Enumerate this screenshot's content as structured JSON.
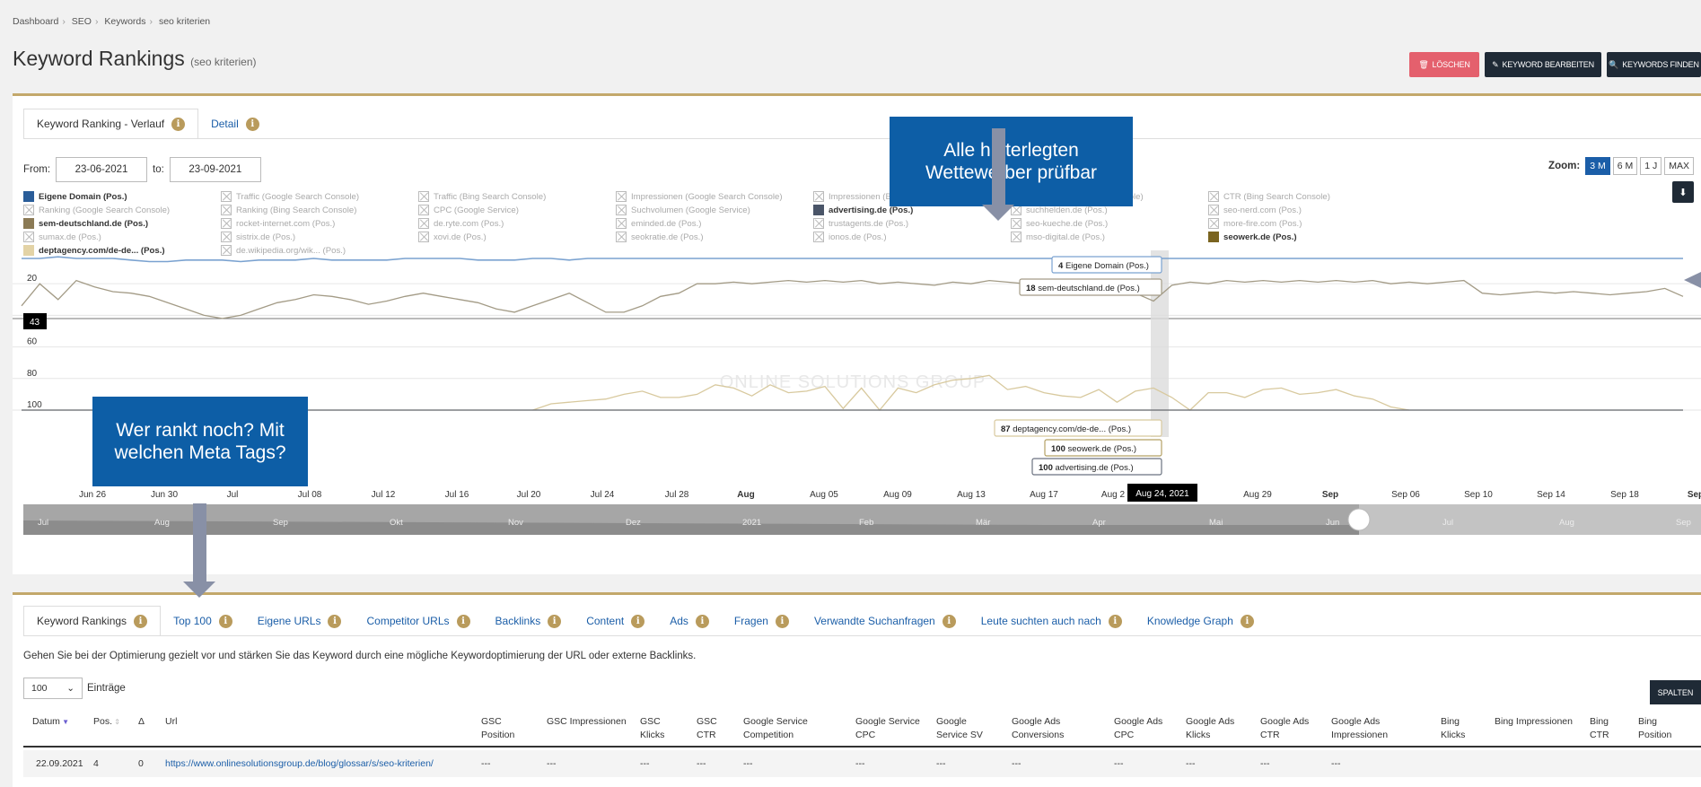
{
  "breadcrumb": [
    "Dashboard",
    "SEO",
    "Keywords",
    "seo kriterien"
  ],
  "page": {
    "title": "Keyword Rankings",
    "subtitle": "(seo kriterien)"
  },
  "actions": {
    "delete": "LÖSCHEN",
    "edit": "KEYWORD BEARBEITEN",
    "find": "KEYWORDS FINDEN"
  },
  "chart_tabs": [
    {
      "label": "Keyword Ranking - Verlauf"
    },
    {
      "label": "Detail"
    }
  ],
  "date_range": {
    "from_label": "From:",
    "from": "23-06-2021",
    "to_label": "to:",
    "to": "23-09-2021"
  },
  "zoom": {
    "label": "Zoom:",
    "options": [
      "3 M",
      "6 M",
      "1 J",
      "MAX"
    ],
    "active": "3 M"
  },
  "legend": [
    {
      "label": "Eigene Domain (Pos.)",
      "active": true,
      "color": "#2a5d99"
    },
    {
      "label": "Traffic (Google Search Console)",
      "active": false
    },
    {
      "label": "Traffic (Bing Search Console)",
      "active": false
    },
    {
      "label": "Impressionen (Google Search Console)",
      "active": false
    },
    {
      "label": "Impressionen (Bing Search Console)",
      "active": false
    },
    {
      "label": "CTR (Google Search Console)",
      "active": false
    },
    {
      "label": "CTR (Bing Search Console)",
      "active": false
    },
    {
      "label": "Ranking (Google Search Console)",
      "active": false
    },
    {
      "label": "Ranking (Bing Search Console)",
      "active": false
    },
    {
      "label": "CPC (Google Service)",
      "active": false
    },
    {
      "label": "Suchvolumen (Google Service)",
      "active": false
    },
    {
      "label": "advertising.de (Pos.)",
      "active": true,
      "color": "#4a5568"
    },
    {
      "label": "suchhelden.de (Pos.)",
      "active": false
    },
    {
      "label": "seo-nerd.com (Pos.)",
      "active": false
    },
    {
      "label": "sem-deutschland.de (Pos.)",
      "active": true,
      "color": "#8b7a55"
    },
    {
      "label": "rocket-internet.com (Pos.)",
      "active": false
    },
    {
      "label": "de.ryte.com (Pos.)",
      "active": false
    },
    {
      "label": "eminded.de (Pos.)",
      "active": false
    },
    {
      "label": "trustagents.de (Pos.)",
      "active": false
    },
    {
      "label": "seo-kueche.de (Pos.)",
      "active": false
    },
    {
      "label": "more-fire.com (Pos.)",
      "active": false
    },
    {
      "label": "sumax.de (Pos.)",
      "active": false
    },
    {
      "label": "sistrix.de (Pos.)",
      "active": false
    },
    {
      "label": "xovi.de (Pos.)",
      "active": false
    },
    {
      "label": "seokratie.de (Pos.)",
      "active": false
    },
    {
      "label": "ionos.de (Pos.)",
      "active": false
    },
    {
      "label": "mso-digital.de (Pos.)",
      "active": false
    },
    {
      "label": "seowerk.de (Pos.)",
      "active": true,
      "color": "#7a6420"
    },
    {
      "label": "deptagency.com/de-de... (Pos.)",
      "active": true,
      "color": "#e3d3a6"
    },
    {
      "label": "de.wikipedia.org/wik... (Pos.)",
      "active": false
    }
  ],
  "chart_data": {
    "type": "line",
    "y_reversed": true,
    "yticks": [
      "20",
      "60",
      "80",
      "100"
    ],
    "x_ticks": [
      "Jun 26",
      "Jun 30",
      "Jul",
      "Jul 08",
      "Jul 12",
      "Jul 16",
      "Jul 20",
      "Jul 24",
      "Jul 28",
      "Aug",
      "Aug 05",
      "Aug 09",
      "Aug 13",
      "Aug 17",
      "Aug 2",
      "5",
      "Aug 29",
      "Sep",
      "Sep 06",
      "Sep 10",
      "Sep 14",
      "Sep 18",
      "Sep"
    ],
    "x_bold": [
      "Aug",
      "Sep"
    ],
    "navigator_ticks": [
      "Jul",
      "Aug",
      "Sep",
      "Okt",
      "Nov",
      "Dez",
      "2021",
      "Feb",
      "Mär",
      "Apr",
      "Mai",
      "Jun",
      "Jul",
      "Aug",
      "Sep"
    ],
    "crosshair_date": "Aug 24, 2021",
    "crosshair_value": "43",
    "watermark": "ONLINE SOLUTIONS GROUP",
    "series": [
      {
        "name": "Eigene Domain (Pos.)",
        "color": "#7aa2d0",
        "values": [
          4,
          4,
          3,
          4,
          4,
          4,
          5,
          6,
          6,
          5,
          5,
          5,
          6,
          5,
          5,
          5,
          4,
          5,
          5,
          5,
          5,
          4,
          4,
          4,
          4,
          5,
          5,
          5,
          4,
          4,
          5,
          4,
          4,
          4,
          4,
          4,
          4,
          4,
          4,
          4,
          4,
          4,
          4,
          4,
          4,
          4,
          4,
          4,
          4,
          4,
          4,
          4,
          4,
          4,
          4,
          4,
          4,
          4,
          4,
          4,
          4,
          4,
          4,
          4,
          4,
          4,
          4,
          4,
          4,
          4,
          4,
          4,
          4,
          4,
          4,
          4,
          4,
          4,
          4,
          4,
          4,
          4,
          4,
          4,
          4,
          4,
          4,
          4,
          4,
          4,
          4,
          4
        ]
      },
      {
        "name": "sem-deutschland.de (Pos.)",
        "color": "#a39b86",
        "values": [
          34,
          20,
          30,
          18,
          22,
          25,
          26,
          28,
          32,
          36,
          40,
          42,
          40,
          36,
          32,
          30,
          27,
          28,
          30,
          33,
          31,
          28,
          26,
          28,
          30,
          32,
          36,
          38,
          34,
          30,
          26,
          32,
          38,
          38,
          34,
          28,
          26,
          20,
          20,
          19,
          20,
          19,
          18,
          19,
          18,
          19,
          18,
          20,
          19,
          20,
          21,
          19,
          20,
          18,
          19,
          20,
          21,
          20,
          19,
          20,
          21,
          26,
          31,
          21,
          19,
          20,
          18,
          19,
          18,
          19,
          18,
          19,
          18,
          19,
          18,
          20,
          19,
          20,
          19,
          18,
          26,
          27,
          26,
          25,
          26,
          25,
          26,
          27,
          26,
          25,
          23,
          28
        ]
      },
      {
        "name": "deptagency.com/de-de... (Pos.)",
        "color": "#d8c99e",
        "values": [
          null,
          null,
          null,
          null,
          null,
          null,
          null,
          null,
          null,
          null,
          null,
          null,
          null,
          null,
          null,
          null,
          null,
          null,
          null,
          null,
          null,
          null,
          null,
          null,
          null,
          null,
          null,
          null,
          100,
          96,
          95,
          94,
          93,
          90,
          88,
          92,
          92,
          90,
          84,
          86,
          91,
          84,
          89,
          88,
          85,
          99,
          86,
          100,
          86,
          89,
          84,
          81,
          80,
          78,
          87,
          85,
          89,
          91,
          92,
          87,
          95,
          88,
          86,
          92,
          100,
          89,
          89,
          92,
          87,
          86,
          90,
          89,
          87,
          91,
          93,
          98,
          100
        ]
      },
      {
        "name": "seowerk.de (Pos.)",
        "color": "#b3a064",
        "values": [
          100,
          100,
          100,
          100,
          100,
          100,
          100,
          100,
          100,
          100,
          100,
          100,
          100,
          100,
          100,
          100,
          100,
          100,
          100,
          100,
          100,
          100,
          100,
          100,
          100,
          100,
          100,
          100,
          100,
          100,
          100,
          100,
          100,
          100,
          100,
          100,
          100,
          100,
          100,
          100,
          100,
          100,
          100,
          100,
          100,
          100,
          100,
          100,
          100,
          100,
          100,
          100,
          100,
          100,
          100,
          100,
          100,
          100,
          100,
          100,
          100,
          100,
          100,
          100,
          100,
          100,
          100,
          100,
          100,
          100,
          100,
          100,
          100,
          100,
          100,
          100,
          100,
          100,
          100,
          100,
          100,
          100,
          100,
          100,
          100,
          100,
          100,
          100,
          100,
          100,
          100,
          100
        ]
      },
      {
        "name": "advertising.de (Pos.)",
        "color": "#6b7280",
        "values": [
          100,
          100,
          100,
          100,
          100,
          100,
          100,
          100,
          100,
          100,
          100,
          100,
          100,
          100,
          100,
          100,
          100,
          100,
          100,
          100,
          100,
          100,
          100,
          100,
          100,
          100,
          100,
          100,
          100,
          100,
          100,
          100,
          100,
          100,
          100,
          100,
          100,
          100,
          100,
          100,
          100,
          100,
          100,
          100,
          100,
          100,
          100,
          100,
          100,
          100,
          100,
          100,
          100,
          100,
          100,
          100,
          100,
          100,
          100,
          100,
          100,
          100,
          100,
          100,
          100,
          100,
          100,
          100,
          100,
          100,
          100,
          100,
          100,
          100,
          100,
          100,
          100,
          100,
          100,
          100,
          100,
          100,
          100,
          100,
          100,
          100,
          100,
          100,
          100,
          100,
          100,
          100
        ]
      }
    ],
    "tooltips": [
      {
        "value": "4",
        "label": "Eigene Domain (Pos.)",
        "color": "#7aa2d0"
      },
      {
        "value": "18",
        "label": "sem-deutschland.de (Pos.)",
        "color": "#a39b86"
      },
      {
        "value": "87",
        "label": "deptagency.com/de-de... (Pos.)",
        "color": "#d8c99e"
      },
      {
        "value": "100",
        "label": "seowerk.de (Pos.)",
        "color": "#b3a064"
      },
      {
        "value": "100",
        "label": "advertising.de (Pos.)",
        "color": "#6b7280"
      }
    ]
  },
  "callouts": {
    "top": "Alle hinterlegten Wettewerber prüfbar",
    "left": "Wer rankt noch? Mit welchen Meta Tags?"
  },
  "table_tabs": [
    {
      "label": "Keyword Rankings"
    },
    {
      "label": "Top 100"
    },
    {
      "label": "Eigene URLs"
    },
    {
      "label": "Competitor URLs"
    },
    {
      "label": "Backlinks"
    },
    {
      "label": "Content"
    },
    {
      "label": "Ads"
    },
    {
      "label": "Fragen"
    },
    {
      "label": "Verwandte Suchanfragen"
    },
    {
      "label": "Leute suchten auch nach"
    },
    {
      "label": "Knowledge Graph"
    }
  ],
  "table_description": "Gehen Sie bei der Optimierung gezielt vor und stärken Sie das Keyword durch eine mögliche Keywordoptimierung der URL oder externe Backlinks.",
  "page_length": {
    "value": "100",
    "suffix": "Einträge"
  },
  "columns_button": "SPALTEN",
  "table": {
    "headers": [
      "Datum",
      "Pos.",
      "Δ",
      "Url",
      "GSC Position",
      "GSC Impressionen",
      "GSC Klicks",
      "GSC CTR",
      "Google Service Competition",
      "Google Service CPC",
      "Google Service SV",
      "Google Ads Conversions",
      "Google Ads CPC",
      "Google Ads Klicks",
      "Google Ads CTR",
      "Google Ads Impressionen",
      "Bing Klicks",
      "Bing Impressionen",
      "Bing CTR",
      "Bing Position"
    ],
    "rows": [
      [
        "22.09.2021",
        "4",
        "0",
        "https://www.onlinesolutionsgroup.de/blog/glossar/s/seo-kriterien/",
        "---",
        "---",
        "---",
        "---",
        "---",
        "---",
        "---",
        "---",
        "---",
        "---",
        "---",
        "---",
        "",
        "",
        "",
        ""
      ]
    ]
  }
}
